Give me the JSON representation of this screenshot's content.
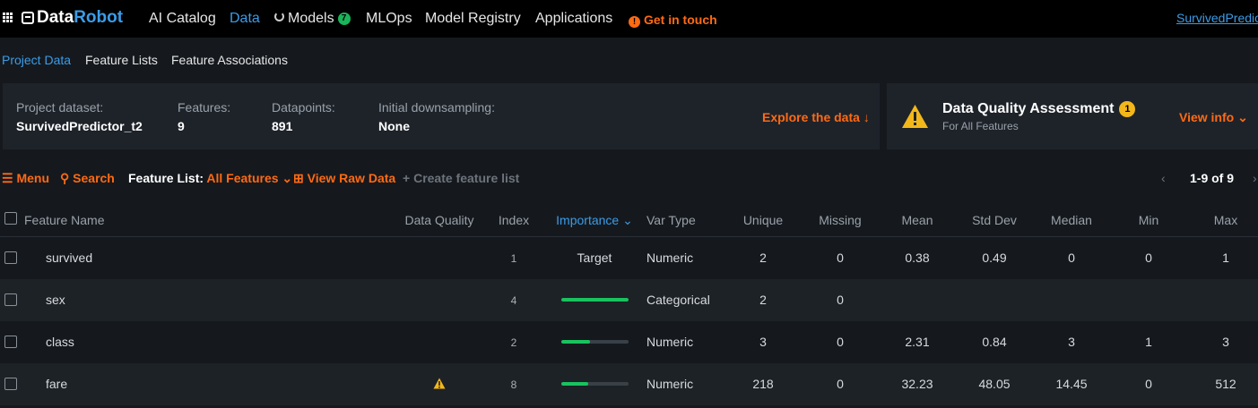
{
  "nav": {
    "logo_part1": "Data",
    "logo_part2": "Robot",
    "items": [
      {
        "label": "AI Catalog"
      },
      {
        "label": "Data"
      },
      {
        "label": "Models"
      },
      {
        "label": "MLOps"
      },
      {
        "label": "Model Registry"
      },
      {
        "label": "Applications"
      }
    ],
    "models_badge": "7",
    "get_in_touch": "Get in touch",
    "project_name": "SurvivedPredic"
  },
  "subnav": {
    "tabs": [
      {
        "label": "Project Data"
      },
      {
        "label": "Feature Lists"
      },
      {
        "label": "Feature Associations"
      }
    ]
  },
  "summary": {
    "dataset_label": "Project dataset:",
    "dataset_value": "SurvivedPredictor_t2",
    "features_label": "Features:",
    "features_value": "9",
    "datapoints_label": "Datapoints:",
    "datapoints_value": "891",
    "downsampling_label": "Initial downsampling:",
    "downsampling_value": "None",
    "explore": "Explore the data"
  },
  "dqa": {
    "title": "Data Quality Assessment",
    "badge": "1",
    "subtitle": "For All Features",
    "view_info": "View info"
  },
  "toolbar": {
    "menu": "Menu",
    "search": "Search",
    "feature_list_label": "Feature List:",
    "feature_list_value": "All Features",
    "view_raw": "View Raw Data",
    "create_list": "Create feature list",
    "pager": "1-9 of 9"
  },
  "table": {
    "headers": {
      "name": "Feature Name",
      "quality": "Data Quality",
      "index": "Index",
      "importance": "Importance",
      "vartype": "Var Type",
      "unique": "Unique",
      "missing": "Missing",
      "mean": "Mean",
      "std": "Std Dev",
      "median": "Median",
      "min": "Min",
      "max": "Max"
    },
    "rows": [
      {
        "name": "survived",
        "quality_warning": false,
        "index": "1",
        "importance_text": "Target",
        "importance": null,
        "vartype": "Numeric",
        "unique": "2",
        "missing": "0",
        "mean": "0.38",
        "std": "0.49",
        "median": "0",
        "min": "0",
        "max": "1"
      },
      {
        "name": "sex",
        "quality_warning": false,
        "index": "4",
        "importance_text": "",
        "importance": 1.0,
        "vartype": "Categorical",
        "unique": "2",
        "missing": "0",
        "mean": "",
        "std": "",
        "median": "",
        "min": "",
        "max": ""
      },
      {
        "name": "class",
        "quality_warning": false,
        "index": "2",
        "importance_text": "",
        "importance": 0.42,
        "vartype": "Numeric",
        "unique": "3",
        "missing": "0",
        "mean": "2.31",
        "std": "0.84",
        "median": "3",
        "min": "1",
        "max": "3"
      },
      {
        "name": "fare",
        "quality_warning": true,
        "index": "8",
        "importance_text": "",
        "importance": 0.4,
        "vartype": "Numeric",
        "unique": "218",
        "missing": "0",
        "mean": "32.23",
        "std": "48.05",
        "median": "14.45",
        "min": "0",
        "max": "512"
      }
    ]
  },
  "colors": {
    "accent_orange": "#ff6a13",
    "accent_blue": "#3b9ce8",
    "importance_green": "#19c25e",
    "warning_yellow": "#f3b71a"
  }
}
